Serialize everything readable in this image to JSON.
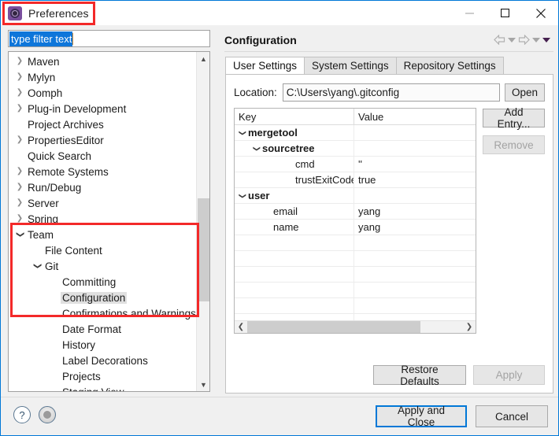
{
  "window": {
    "title": "Preferences",
    "icon": "preferences-gear-icon",
    "controls": {
      "minimize": "minimize-icon",
      "maximize": "maximize-icon",
      "close": "close-icon"
    }
  },
  "filter": {
    "value": "type filter text",
    "placeholder": "type filter text"
  },
  "tree": {
    "items": [
      {
        "label": "Maven",
        "indent": 0,
        "arrow": "collapsed",
        "selected": false
      },
      {
        "label": "Mylyn",
        "indent": 0,
        "arrow": "collapsed",
        "selected": false
      },
      {
        "label": "Oomph",
        "indent": 0,
        "arrow": "collapsed",
        "selected": false
      },
      {
        "label": "Plug-in Development",
        "indent": 0,
        "arrow": "collapsed",
        "selected": false
      },
      {
        "label": "Project Archives",
        "indent": 0,
        "arrow": "none",
        "selected": false
      },
      {
        "label": "PropertiesEditor",
        "indent": 0,
        "arrow": "collapsed",
        "selected": false
      },
      {
        "label": "Quick Search",
        "indent": 0,
        "arrow": "none",
        "selected": false
      },
      {
        "label": "Remote Systems",
        "indent": 0,
        "arrow": "collapsed",
        "selected": false
      },
      {
        "label": "Run/Debug",
        "indent": 0,
        "arrow": "collapsed",
        "selected": false
      },
      {
        "label": "Server",
        "indent": 0,
        "arrow": "collapsed",
        "selected": false
      },
      {
        "label": "Spring",
        "indent": 0,
        "arrow": "collapsed",
        "selected": false
      },
      {
        "label": "Team",
        "indent": 0,
        "arrow": "expanded",
        "selected": false
      },
      {
        "label": "File Content",
        "indent": 1,
        "arrow": "none",
        "selected": false
      },
      {
        "label": "Git",
        "indent": 1,
        "arrow": "expanded",
        "selected": false
      },
      {
        "label": "Committing",
        "indent": 2,
        "arrow": "none",
        "selected": false
      },
      {
        "label": "Configuration",
        "indent": 2,
        "arrow": "none",
        "selected": true
      },
      {
        "label": "Confirmations and Warnings",
        "indent": 2,
        "arrow": "none",
        "selected": false
      },
      {
        "label": "Date Format",
        "indent": 2,
        "arrow": "none",
        "selected": false
      },
      {
        "label": "History",
        "indent": 2,
        "arrow": "none",
        "selected": false
      },
      {
        "label": "Label Decorations",
        "indent": 2,
        "arrow": "none",
        "selected": false
      },
      {
        "label": "Projects",
        "indent": 2,
        "arrow": "none",
        "selected": false
      },
      {
        "label": "Staging View",
        "indent": 2,
        "arrow": "none",
        "selected": false
      }
    ],
    "scrollbar": {
      "up": "chevron-up-icon",
      "down": "chevron-down-icon"
    }
  },
  "pane": {
    "title": "Configuration",
    "nav": {
      "back": "back-arrow-icon",
      "back_menu": "dropdown-arrow-icon",
      "forward": "forward-arrow-icon",
      "forward_menu": "dropdown-arrow-icon",
      "view_menu": "view-menu-arrow-icon"
    },
    "tabs": [
      {
        "label": "User Settings",
        "active": true
      },
      {
        "label": "System Settings",
        "active": false
      },
      {
        "label": "Repository Settings",
        "active": false
      }
    ],
    "location": {
      "label": "Location:",
      "value": "C:\\Users\\yang\\.gitconfig",
      "open_label": "Open"
    },
    "table": {
      "columns": [
        "Key",
        "Value"
      ],
      "rows": [
        {
          "key": "mergetool",
          "value": "",
          "indent": 0,
          "arrow": "expanded",
          "bold": true
        },
        {
          "key": "sourcetree",
          "value": "",
          "indent": 1,
          "arrow": "expanded",
          "bold": true
        },
        {
          "key": "cmd",
          "value": "''",
          "indent": 2,
          "arrow": "none",
          "bold": false
        },
        {
          "key": "trustExitCode",
          "value": "true",
          "indent": 2,
          "arrow": "none",
          "bold": false
        },
        {
          "key": "user",
          "value": "",
          "indent": 0,
          "arrow": "expanded",
          "bold": true
        },
        {
          "key": "email",
          "value": "yang",
          "indent": 1,
          "arrow": "none",
          "bold": false
        },
        {
          "key": "name",
          "value": "yang",
          "indent": 1,
          "arrow": "none",
          "bold": false
        },
        {
          "key": "",
          "value": "",
          "indent": 0,
          "arrow": "none",
          "bold": false
        },
        {
          "key": "",
          "value": "",
          "indent": 0,
          "arrow": "none",
          "bold": false
        },
        {
          "key": "",
          "value": "",
          "indent": 0,
          "arrow": "none",
          "bold": false
        },
        {
          "key": "",
          "value": "",
          "indent": 0,
          "arrow": "none",
          "bold": false
        },
        {
          "key": "",
          "value": "",
          "indent": 0,
          "arrow": "none",
          "bold": false
        },
        {
          "key": "",
          "value": "",
          "indent": 0,
          "arrow": "none",
          "bold": false
        }
      ],
      "hscroll": {
        "left": "chevron-left-icon",
        "right": "chevron-right-icon"
      }
    },
    "side_buttons": [
      {
        "label": "Add Entry...",
        "enabled": true
      },
      {
        "label": "Remove",
        "enabled": false
      }
    ],
    "panel_actions": [
      {
        "label": "Restore Defaults",
        "enabled": true
      },
      {
        "label": "Apply",
        "enabled": false
      }
    ]
  },
  "footer": {
    "help_icon": "help-question-icon",
    "help_glyph": "?",
    "secondary_icon": "grey-circle-icon",
    "buttons": [
      {
        "label": "Apply and Close",
        "default": true
      },
      {
        "label": "Cancel",
        "default": false
      }
    ]
  },
  "annotations": [
    {
      "name": "title-highlight"
    },
    {
      "name": "tree-highlight"
    }
  ],
  "colors": {
    "accent": "#0078d7",
    "annotation": "#f32929",
    "selection": "#0e76da"
  }
}
